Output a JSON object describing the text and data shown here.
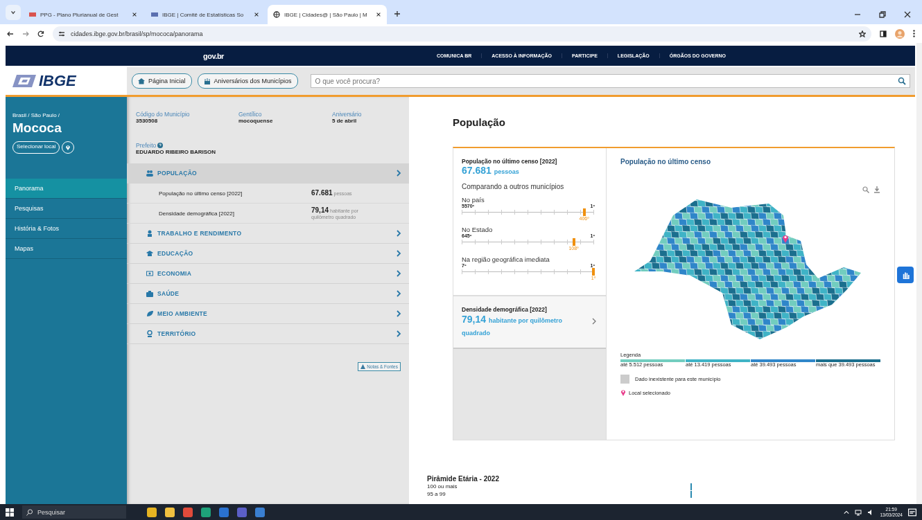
{
  "browser": {
    "tabs": [
      {
        "title": "PPG - Plano Plurianual de Gest",
        "selected": false
      },
      {
        "title": "IBGE | Comitê de Estatísticas So",
        "selected": false
      },
      {
        "title": "IBGE | Cidades@ | São Paulo | M",
        "selected": true
      }
    ],
    "url": "cidades.ibge.gov.br/brasil/sp/mococa/panorama"
  },
  "gov_bar": {
    "logo": "gov.br",
    "links": [
      "COMUNICA BR",
      "ACESSO À INFORMAÇÃO",
      "PARTICIPE",
      "LEGISLAÇÃO",
      "ÓRGÃOS DO GOVERNO"
    ]
  },
  "header": {
    "logo": "IBGE",
    "buttons": [
      "Página Inicial",
      "Aniversários dos Municípios"
    ],
    "search": {
      "placeholder": "O que você procura?"
    }
  },
  "sidebar": {
    "breadcrumb": "Brasil / São Paulo /",
    "city": "Mococa",
    "select_button": "Selecionar local",
    "items": [
      {
        "label": "Panorama",
        "selected": true
      },
      {
        "label": "Pesquisas",
        "selected": false
      },
      {
        "label": "História & Fotos",
        "selected": false
      },
      {
        "label": "Mapas",
        "selected": false
      }
    ]
  },
  "summary": {
    "fields": [
      {
        "label": "Código do Município",
        "value": "3530508"
      },
      {
        "label": "Gentílico",
        "value": "mocoquense"
      },
      {
        "label": "Aniversário",
        "value": "5 de abril"
      }
    ],
    "mayor": {
      "label": "Prefeito",
      "value": "EDUARDO RIBEIRO BARISON"
    }
  },
  "topics": [
    {
      "label": "POPULAÇÃO",
      "expanded": true,
      "rows": [
        {
          "label": "População no último censo [2022]",
          "value": "67.681",
          "unit": "pessoas"
        },
        {
          "label": "Densidade demográfica [2022]",
          "value": "79,14",
          "unit": "habitante por quilômetro quadrado"
        }
      ]
    },
    {
      "label": "TRABALHO E RENDIMENTO",
      "expanded": false
    },
    {
      "label": "EDUCAÇÃO",
      "expanded": false
    },
    {
      "label": "ECONOMIA",
      "expanded": false
    },
    {
      "label": "SAÚDE",
      "expanded": false
    },
    {
      "label": "MEIO AMBIENTE",
      "expanded": false
    },
    {
      "label": "TERRITÓRIO",
      "expanded": false
    }
  ],
  "notes_button": "Notas & Fontes",
  "panel": {
    "title": "População",
    "census": {
      "title": "População no último censo [2022]",
      "value": "67.681",
      "unit": "pessoas"
    },
    "compare_title": "Comparando a outros municípios",
    "rankings": [
      {
        "label": "No país",
        "min": "5570º",
        "max": "1º",
        "reading": "406º",
        "level": 0.93
      },
      {
        "label": "No Estado",
        "min": "645º",
        "max": "1º",
        "reading": "108º",
        "level": 0.85
      },
      {
        "label": "Na região geográfica imediata",
        "min": "7º",
        "max": "1º",
        "reading": "1º",
        "level": 1
      }
    ],
    "density": {
      "title": "Densidade demográfica [2022]",
      "value": "79,14",
      "unit": "habitante por quilômetro quadrado"
    },
    "map": {
      "title": "População no último censo",
      "legend_title": "Legenda",
      "legend": [
        {
          "label": "até 5.512 pessoas",
          "color": "#72cdbf"
        },
        {
          "label": "até 13.419 pessoas",
          "color": "#3fb3c6"
        },
        {
          "label": "até 39.493 pessoas",
          "color": "#2f86c9"
        },
        {
          "label": "mais que 39.493 pessoas",
          "color": "#1b6f8e"
        }
      ],
      "missing": "Dado inexistente para este município",
      "selected_place": "Local selecionado"
    }
  },
  "pyramid": {
    "title": "Pirâmide Etária - 2022",
    "labels": [
      "100 ou mais",
      "95 a 99"
    ]
  },
  "taskbar": {
    "search_placeholder": "Pesquisar",
    "time": "21:59",
    "date": "13/03/2024"
  }
}
